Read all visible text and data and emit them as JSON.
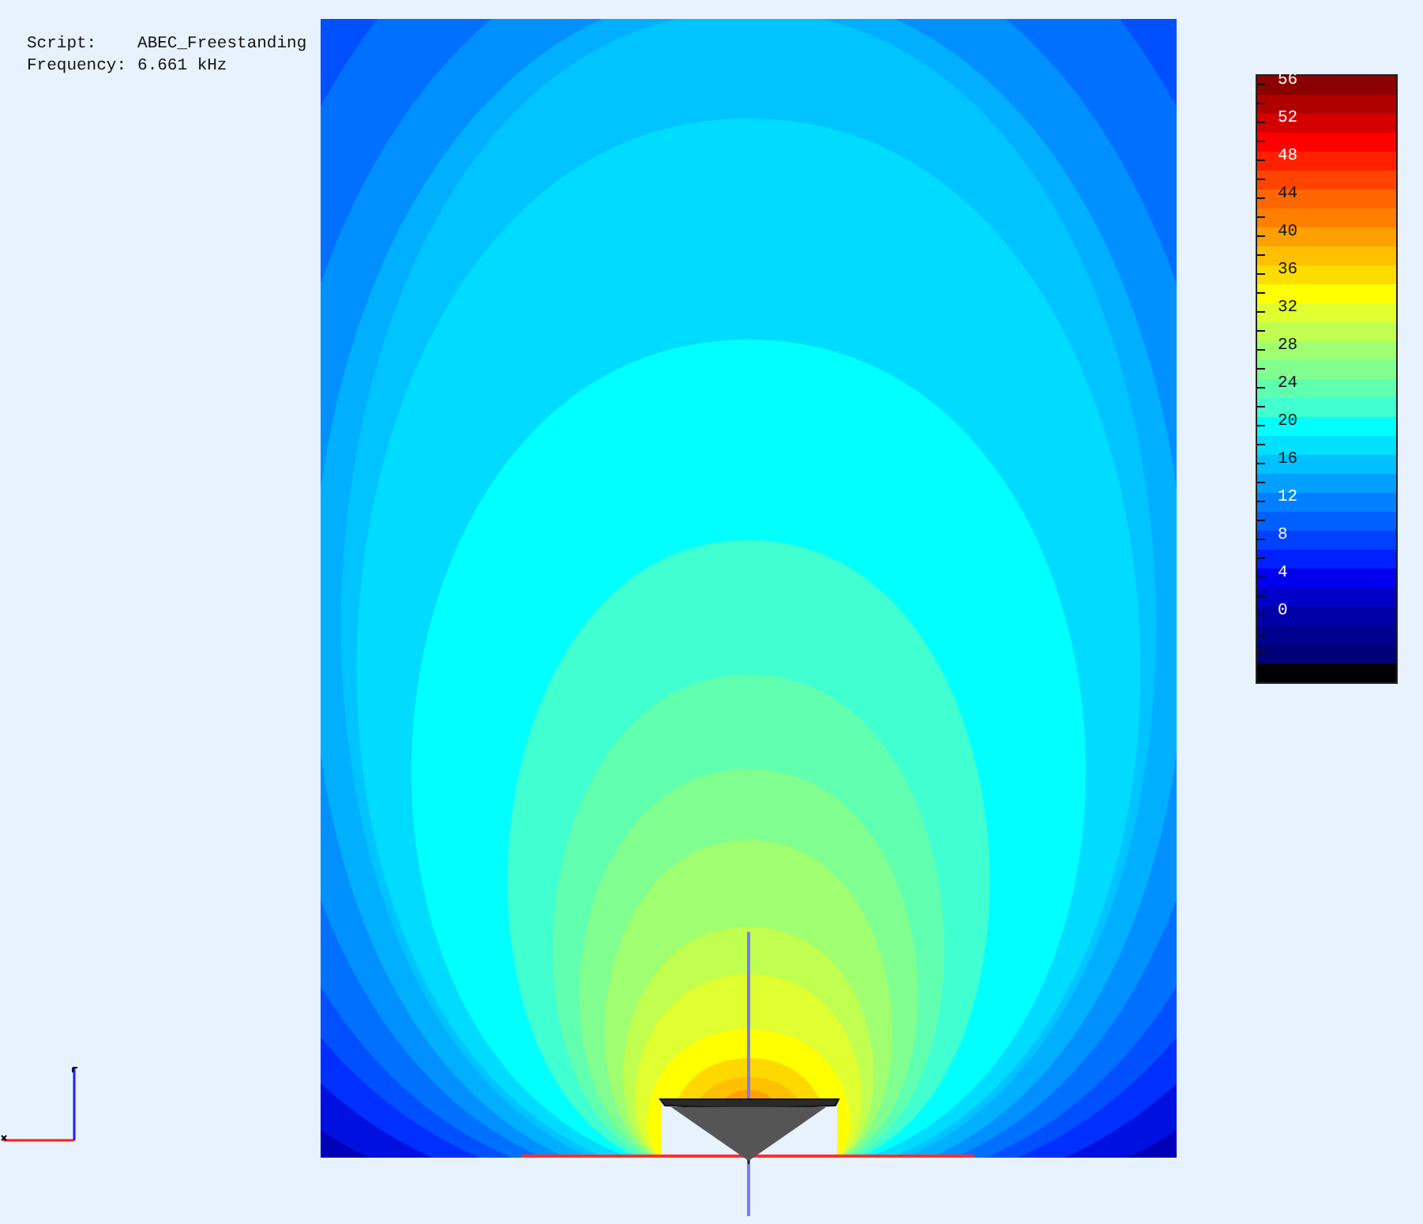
{
  "info": [
    {
      "label": "Script:",
      "value": "ABEC_Freestanding"
    },
    {
      "label": "Frequency:",
      "value": "6.661 kHz"
    }
  ],
  "color_scale": [
    {
      "color": "#8b0000",
      "label": "56"
    },
    {
      "color": "#b00000"
    },
    {
      "color": "#d40000",
      "label": "52"
    },
    {
      "color": "#ff0000"
    },
    {
      "color": "#ff2000",
      "label": "48"
    },
    {
      "color": "#ff4400"
    },
    {
      "color": "#ff6600",
      "label": "44"
    },
    {
      "color": "#ff8000"
    },
    {
      "color": "#ffa000",
      "label": "40"
    },
    {
      "color": "#ffc000"
    },
    {
      "color": "#ffdc00",
      "label": "36"
    },
    {
      "color": "#ffff00"
    },
    {
      "color": "#e0ff30",
      "label": "32"
    },
    {
      "color": "#c0ff50"
    },
    {
      "color": "#a0ff70",
      "label": "28"
    },
    {
      "color": "#80ff90"
    },
    {
      "color": "#5fffb0",
      "label": "24"
    },
    {
      "color": "#40ffd0"
    },
    {
      "color": "#00ffff",
      "label": "20"
    },
    {
      "color": "#00e0ff"
    },
    {
      "color": "#00c0ff",
      "label": "16"
    },
    {
      "color": "#00a0ff"
    },
    {
      "color": "#0080ff",
      "label": "12"
    },
    {
      "color": "#0060ff"
    },
    {
      "color": "#0040ff",
      "label": "8"
    },
    {
      "color": "#0020ff"
    },
    {
      "color": "#0000ee",
      "label": "4"
    },
    {
      "color": "#0000c8"
    },
    {
      "color": "#0000a8",
      "label": "0"
    },
    {
      "color": "#000090"
    },
    {
      "color": "#000078"
    },
    {
      "color": "#000000"
    }
  ]
}
